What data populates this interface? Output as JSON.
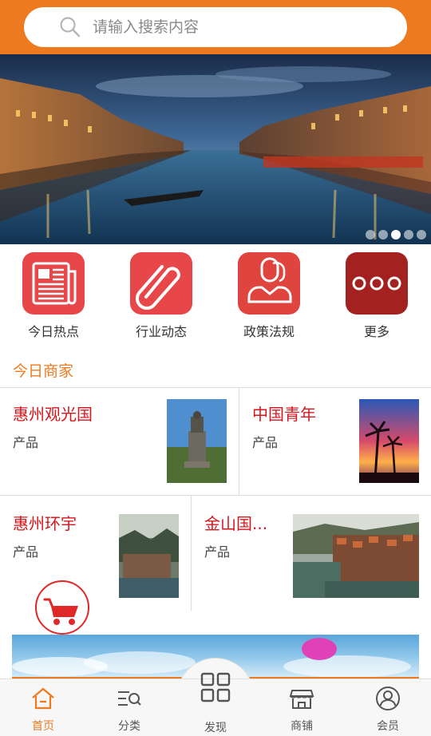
{
  "search": {
    "placeholder": "请输入搜索内容",
    "icon": "search-icon"
  },
  "banner": {
    "slide_count": 5,
    "active_slide": 3
  },
  "categories": [
    {
      "label": "今日热点",
      "icon": "newspaper-icon",
      "color": "#e8474a"
    },
    {
      "label": "行业动态",
      "icon": "paperclip-icon",
      "color": "#e8474a"
    },
    {
      "label": "政策法规",
      "icon": "people-icon",
      "color": "#e0443f"
    },
    {
      "label": "更多",
      "icon": "more-dots-icon",
      "color": "#a3211f"
    }
  ],
  "section": {
    "title": "今日商家"
  },
  "merchants": [
    {
      "name": "惠州观光国",
      "sub": "产品"
    },
    {
      "name": "中国青年",
      "sub": "产品"
    },
    {
      "name": "惠州环宇",
      "sub": "产品"
    },
    {
      "name": "金山国...",
      "sub": "产品"
    }
  ],
  "tabs": [
    {
      "label": "首页",
      "icon": "home-icon",
      "active": true
    },
    {
      "label": "分类",
      "icon": "category-search-icon",
      "active": false
    },
    {
      "label": "发现",
      "icon": "grid-icon",
      "active": false
    },
    {
      "label": "商铺",
      "icon": "shop-icon",
      "active": false
    },
    {
      "label": "会员",
      "icon": "user-icon",
      "active": false
    }
  ],
  "colors": {
    "accent": "#ee7a1f",
    "merchant_name": "#d8141b"
  }
}
